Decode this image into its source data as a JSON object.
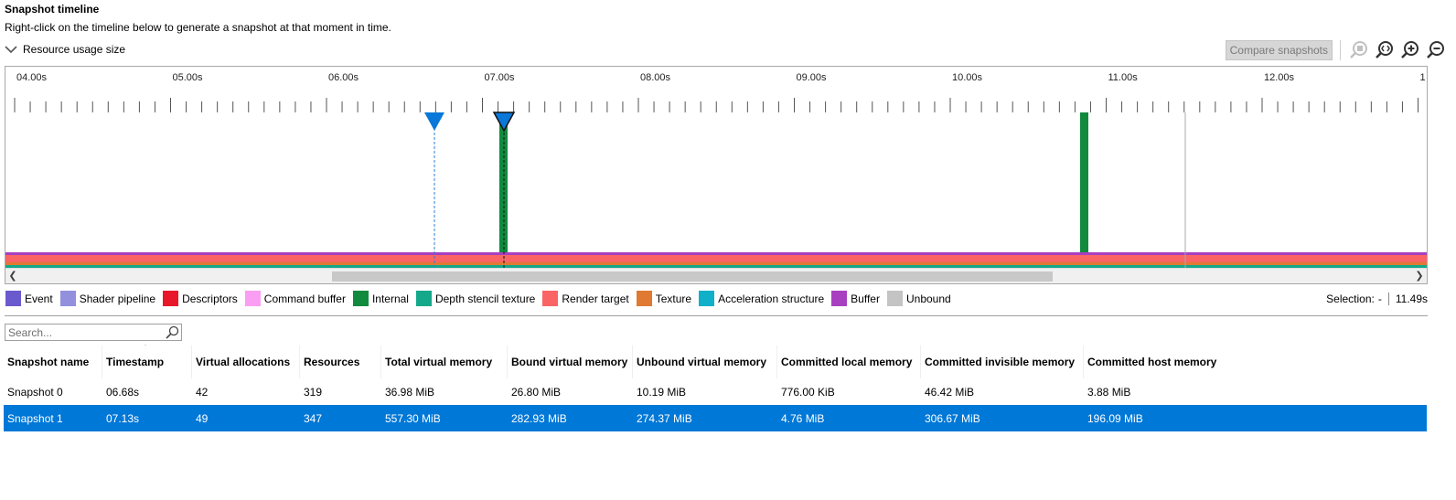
{
  "header": {
    "title": "Snapshot timeline",
    "subtitle": "Right-click on the timeline below to generate a snapshot at that moment in time.",
    "dropdown_label": "Resource usage size"
  },
  "toolbar": {
    "compare_label": "Compare snapshots",
    "icons": [
      "zoom-to-selection-icon",
      "zoom-reset-icon",
      "zoom-in-icon",
      "zoom-out-icon"
    ]
  },
  "timeline": {
    "tick_labels": [
      "04.00s",
      "05.00s",
      "06.00s",
      "07.00s",
      "08.00s",
      "09.00s",
      "10.00s",
      "11.00s",
      "12.00s",
      "1"
    ],
    "snapshot_markers": [
      "06.68s",
      "07.13s"
    ],
    "internal_events": [
      "07.13s",
      "10.88s"
    ],
    "cursor": "11.49s"
  },
  "legend": [
    {
      "label": "Event",
      "color": "#6a5acd"
    },
    {
      "label": "Shader pipeline",
      "color": "#9391dd"
    },
    {
      "label": "Descriptors",
      "color": "#e8182a"
    },
    {
      "label": "Command buffer",
      "color": "#f99ef2"
    },
    {
      "label": "Internal",
      "color": "#118a3e"
    },
    {
      "label": "Depth stencil texture",
      "color": "#14a88a"
    },
    {
      "label": "Render target",
      "color": "#fa6464"
    },
    {
      "label": "Texture",
      "color": "#e07a32"
    },
    {
      "label": "Acceleration structure",
      "color": "#0fb0c8"
    },
    {
      "label": "Buffer",
      "color": "#a83fc0"
    },
    {
      "label": "Unbound",
      "color": "#c4c4c4"
    }
  ],
  "selection": {
    "label": "Selection:",
    "value": "-",
    "time": "11.49s"
  },
  "search": {
    "placeholder": "Search..."
  },
  "table": {
    "columns": [
      "Snapshot name",
      "Timestamp",
      "Virtual allocations",
      "Resources",
      "Total virtual memory",
      "Bound virtual memory",
      "Unbound virtual memory",
      "Committed local memory",
      "Committed invisible memory",
      "Committed host memory"
    ],
    "rows": [
      [
        "Snapshot 0",
        "06.68s",
        "42",
        "319",
        "36.98 MiB",
        "26.80 MiB",
        "10.19 MiB",
        "776.00 KiB",
        "46.42 MiB",
        "3.88 MiB"
      ],
      [
        "Snapshot 1",
        "07.13s",
        "49",
        "347",
        "557.30 MiB",
        "282.93 MiB",
        "274.37 MiB",
        "4.76 MiB",
        "306.67 MiB",
        "196.09 MiB"
      ]
    ],
    "selected_row": 1
  }
}
